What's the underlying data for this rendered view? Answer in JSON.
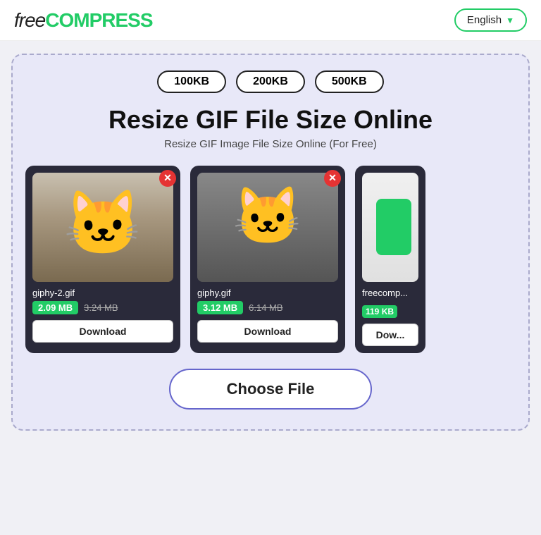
{
  "header": {
    "logo_free": "free",
    "logo_compress": "COMPRESS",
    "lang_label": "English",
    "lang_chevron": "▼"
  },
  "size_pills": [
    "100KB",
    "200KB",
    "500KB"
  ],
  "page": {
    "title": "Resize GIF File Size Online",
    "subtitle": "Resize GIF Image File Size Online (For Free)"
  },
  "cards": [
    {
      "filename": "giphy-2.gif",
      "size_new": "2.09 MB",
      "size_old": "3.24 MB",
      "download_label": "Download"
    },
    {
      "filename": "giphy.gif",
      "size_new": "3.12 MB",
      "size_old": "6.14 MB",
      "download_label": "Download"
    },
    {
      "filename": "freecomp...",
      "size_new": "119 KB",
      "size_old": "",
      "download_label": "Dow..."
    }
  ],
  "choose_file_label": "Choose File"
}
